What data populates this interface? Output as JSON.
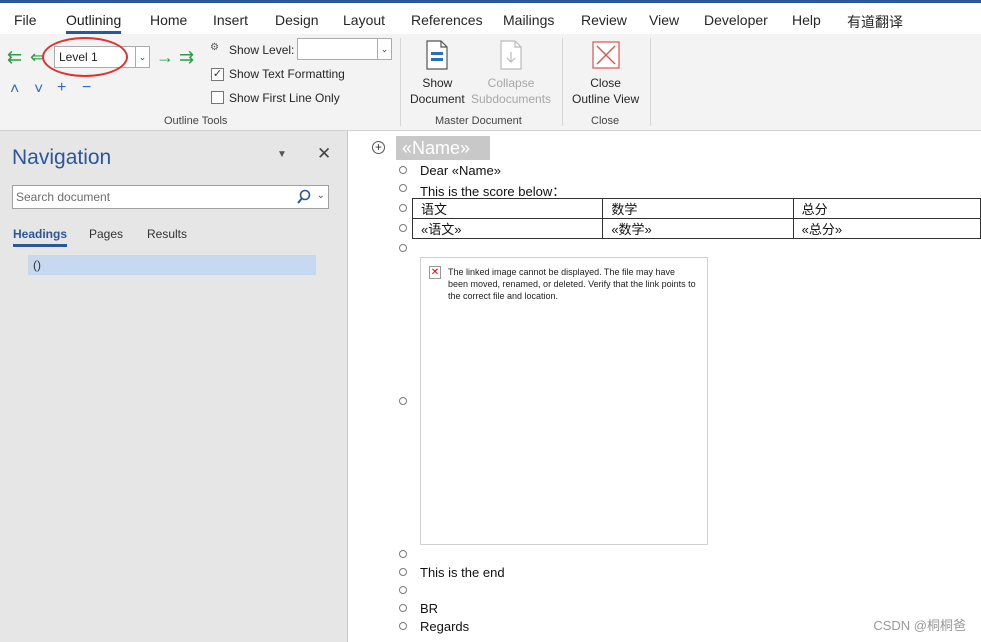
{
  "menu": {
    "tabs": [
      "File",
      "Outlining",
      "Home",
      "Insert",
      "Design",
      "Layout",
      "References",
      "Mailings",
      "Review",
      "View",
      "Developer",
      "Help",
      "有道翻译"
    ],
    "active": "Outlining"
  },
  "ribbon": {
    "outline_tools": {
      "level_value": "Level 1",
      "show_level_label": "Show Level:",
      "show_level_value": "",
      "show_text_formatting_label": "Show Text Formatting",
      "show_text_formatting_checked": true,
      "show_first_line_only_label": "Show First Line Only",
      "show_first_line_only_checked": false,
      "group_label": "Outline Tools"
    },
    "master_document": {
      "show_document_line1": "Show",
      "show_document_line2": "Document",
      "collapse_line1": "Collapse",
      "collapse_line2": "Subdocuments",
      "group_label": "Master Document"
    },
    "close": {
      "close_line1": "Close",
      "close_line2": "Outline View",
      "group_label": "Close"
    }
  },
  "navigation": {
    "title": "Navigation",
    "search_placeholder": "Search document",
    "tabs": [
      "Headings",
      "Pages",
      "Results"
    ],
    "active_tab": "Headings",
    "heading_item": "()"
  },
  "document": {
    "heading": "«Name»",
    "lines": {
      "dear": "Dear «Name»",
      "score": "This is the score below：",
      "end": "This is the end",
      "br": "BR",
      "regards": "Regards"
    },
    "table": {
      "headers": [
        "语文",
        "数学",
        "总分"
      ],
      "values": [
        "«语文»",
        "«数学»",
        "«总分»"
      ]
    },
    "image_error": "The linked image cannot be displayed.  The file may have been moved, renamed, or deleted. Verify that the link points to the correct file and location."
  },
  "watermark": "CSDN @桐桐爸",
  "colors": {
    "accent": "#2b579a",
    "annotation_circle": "#e03131",
    "outline_arrow": "#2e9b48"
  }
}
